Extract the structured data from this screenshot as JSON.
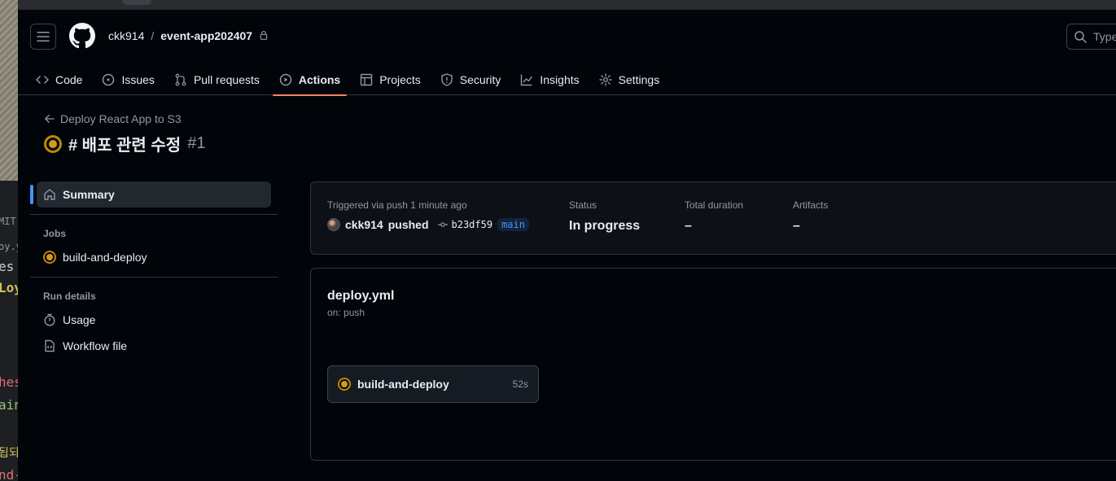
{
  "background_fragments": [
    {
      "text": "MIT",
      "color": "#9198a1"
    },
    {
      "text": "oy.y",
      "color": "#9198a1"
    },
    {
      "text": "es a",
      "color": "#c9d1d9"
    },
    {
      "text": "Loy",
      "color": "#d2c057"
    },
    {
      "text": "hes",
      "color": "#e06c75"
    },
    {
      "text": "ain",
      "color": "#98c379"
    },
    {
      "text": "됩되",
      "color": "#d2c057"
    },
    {
      "text": "nd-",
      "color": "#e06c75"
    }
  ],
  "header": {
    "owner": "ckk914",
    "separator": "/",
    "repo": "event-app202407",
    "search_placeholder": "Type"
  },
  "nav": [
    {
      "label": "Code",
      "icon": "code-icon"
    },
    {
      "label": "Issues",
      "icon": "issue-opened-icon"
    },
    {
      "label": "Pull requests",
      "icon": "git-pull-request-icon"
    },
    {
      "label": "Actions",
      "icon": "play-icon",
      "active": true
    },
    {
      "label": "Projects",
      "icon": "table-icon"
    },
    {
      "label": "Security",
      "icon": "shield-icon"
    },
    {
      "label": "Insights",
      "icon": "graph-icon"
    },
    {
      "label": "Settings",
      "icon": "gear-icon"
    }
  ],
  "run": {
    "back_label": "Deploy React App to S3",
    "title": "# 배포 관련 수정",
    "number": "#1",
    "status_color": "#d29922"
  },
  "sidebar": {
    "summary_label": "Summary",
    "jobs_heading": "Jobs",
    "jobs": [
      {
        "label": "build-and-deploy"
      }
    ],
    "run_details_heading": "Run details",
    "details": [
      {
        "label": "Usage",
        "icon": "stopwatch-icon"
      },
      {
        "label": "Workflow file",
        "icon": "file-code-icon"
      }
    ]
  },
  "summary": {
    "trigger_label": "Triggered via push 1 minute ago",
    "actor": "ckk914",
    "verb": "pushed",
    "commit_sha": "b23df59",
    "branch": "main",
    "status_label": "Status",
    "status_value": "In progress",
    "duration_label": "Total duration",
    "duration_value": "–",
    "artifacts_label": "Artifacts",
    "artifacts_value": "–"
  },
  "workflow": {
    "file_name": "deploy.yml",
    "trigger": "on: push",
    "job_name": "build-and-deploy",
    "job_duration": "52s"
  },
  "colors": {
    "accent_blue": "#4493f8",
    "underline_orange": "#f78166",
    "in_progress_yellow": "#d29922"
  }
}
